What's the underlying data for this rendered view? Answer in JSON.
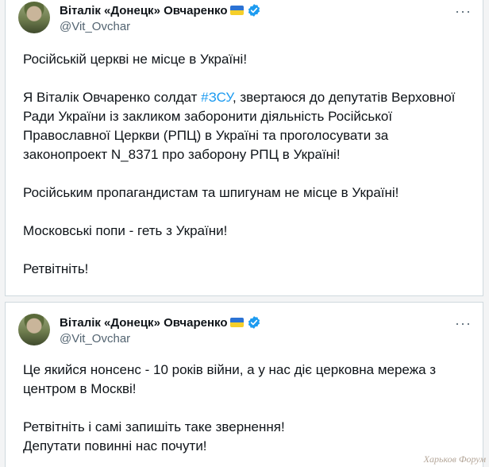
{
  "tweet1": {
    "author_name": "Віталік «Донецк» Овчаренко",
    "handle": "@Vit_Ovchar",
    "more": "···",
    "p1": "Російській церкві не місце в Україні!",
    "p2_before": "Я Віталік Овчаренко солдат ",
    "p2_hashtag": "#ЗСУ",
    "p2_after": ", звертаюся до депутатів Верховної Ради України із закликом заборонити діяльність Російської Православної Церкви (РПЦ) в Україні та проголосувати за законопроект N_8371 про заборону РПЦ в Україні!",
    "p3": "Російським пропагандистам та шпигунам не місце в Україні!",
    "p4": "Московські попи - геть з України!",
    "p5": "Ретвітніть!"
  },
  "tweet2": {
    "author_name": "Віталік «Донецк» Овчаренко",
    "handle": "@Vit_Ovchar",
    "more": "···",
    "p1": "Це якийся нонсенс - 10 років війни, а у нас діє церковна мережа з центром в Москві!",
    "p2_line1": "Ретвітніть і самі запишіть таке звернення!",
    "p2_line2": "Депутати повинні нас почути!"
  },
  "watermark": "Харьков Форум",
  "colors": {
    "accent": "#1d9bf0",
    "secondary_text": "#536471"
  }
}
